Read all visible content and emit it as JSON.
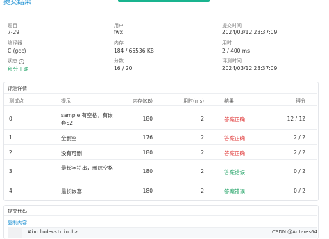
{
  "header": {
    "title": "提交结果"
  },
  "summary": {
    "problem_label": "题目",
    "problem_value": "7-29",
    "user_label": "用户",
    "user_value": "fwx",
    "submit_time_label": "提交时间",
    "submit_time_value": "2024/03/12 23:37:09",
    "compiler_label": "编译器",
    "compiler_value": "C (gcc)",
    "memory_label": "内存",
    "memory_value": "184 / 65536 KB",
    "time_label": "用时",
    "time_value": "2 / 400 ms",
    "status_label": "状态",
    "status_value": "部分正确",
    "score_label": "分数",
    "score_value": "16 / 20",
    "judge_time_label": "评测时间",
    "judge_time_value": "2024/03/12 23:37:09"
  },
  "details": {
    "title": "评测详情",
    "columns": [
      "测试点",
      "提示",
      "内存(KB)",
      "用时(ms)",
      "结果",
      "得分"
    ],
    "rows": [
      {
        "id": "0",
        "hint": "sample 有空格，有嵌套S2",
        "memory": "180",
        "time": "2",
        "result": "答案正确",
        "score": "12 / 12",
        "ok": true
      },
      {
        "id": "1",
        "hint": "全删空",
        "memory": "176",
        "time": "2",
        "result": "答案正确",
        "score": "2 / 2",
        "ok": true
      },
      {
        "id": "2",
        "hint": "没有可删",
        "memory": "180",
        "time": "2",
        "result": "答案正确",
        "score": "2 / 2",
        "ok": true
      },
      {
        "id": "3",
        "hint": "最长字符串，删除空格",
        "memory": "180",
        "time": "2",
        "result": "答案错误",
        "score": "0 / 2",
        "ok": false
      },
      {
        "id": "4",
        "hint": "最长嵌套",
        "memory": "180",
        "time": "2",
        "result": "答案错误",
        "score": "0 / 2",
        "ok": false
      }
    ]
  },
  "code": {
    "title": "提交代码",
    "copy_label": "复制内容",
    "first_line": "#include<stdio.h>"
  },
  "watermark": "CSDN @Antares64",
  "colors": {
    "accent": "#1b8fd2",
    "ok": "#21a366",
    "error": "#e03a3a",
    "progress": "#19b48f"
  }
}
